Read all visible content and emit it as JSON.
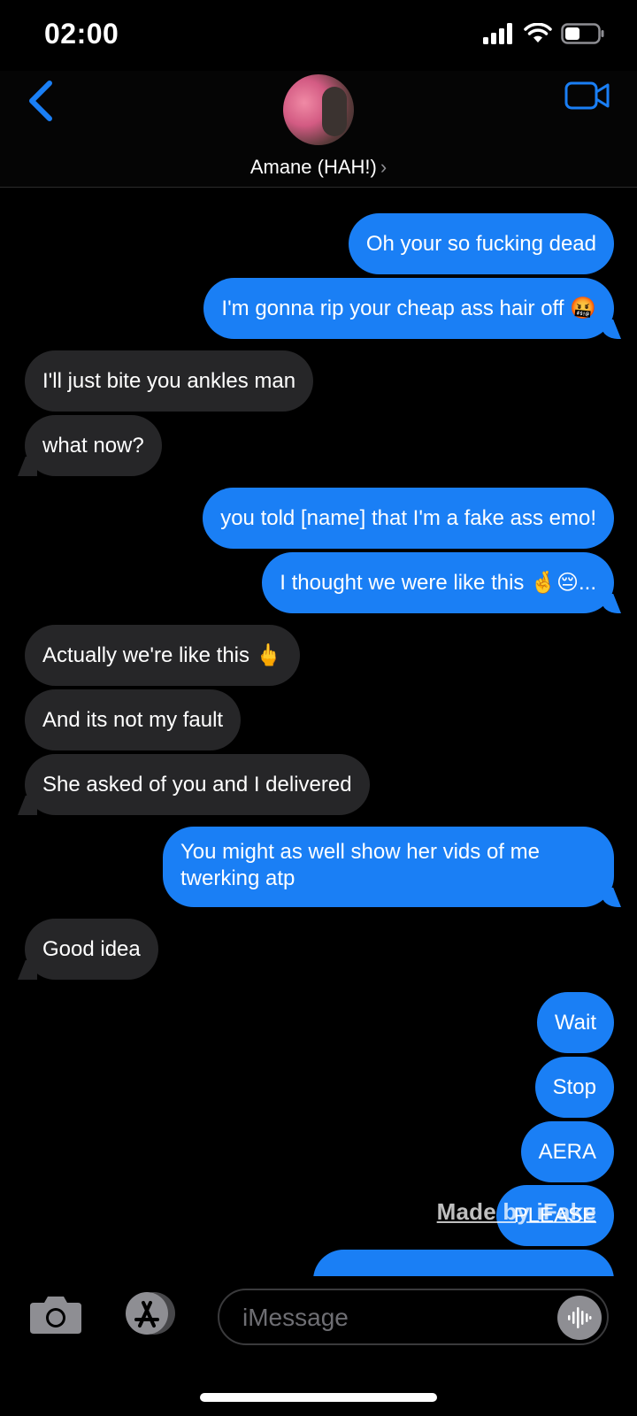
{
  "status_bar": {
    "time": "02:00"
  },
  "header": {
    "contact_name": "Amane (HAH!)",
    "chevron": "›"
  },
  "messages": [
    {
      "side": "sent",
      "text": "Oh your so fucking dead"
    },
    {
      "side": "sent",
      "text": "I'm gonna rip your cheap ass hair off 🤬"
    },
    {
      "side": "received",
      "text": "I'll just bite you ankles man"
    },
    {
      "side": "received",
      "text": "what now?"
    },
    {
      "side": "sent",
      "text": "you told [name] that I'm a fake ass emo!"
    },
    {
      "side": "sent",
      "text": "I thought we were like this 🤞😔..."
    },
    {
      "side": "received",
      "text": "Actually we're like this 🖕"
    },
    {
      "side": "received",
      "text": "And its not my fault"
    },
    {
      "side": "received",
      "text": "She asked of you and I delivered"
    },
    {
      "side": "sent",
      "text": "You might as well show her vids of me twerking atp"
    },
    {
      "side": "received",
      "text": "Good idea"
    },
    {
      "side": "sent",
      "text": "Wait"
    },
    {
      "side": "sent",
      "text": "Stop"
    },
    {
      "side": "sent",
      "text": "AERA"
    },
    {
      "side": "sent",
      "text": "PLEASE"
    }
  ],
  "watermark": "Made by iFake",
  "input": {
    "placeholder": "iMessage"
  },
  "icons": {
    "back": "chevron-left-icon",
    "video": "video-camera-icon",
    "camera": "camera-icon",
    "apps": "app-store-icon",
    "audio": "audio-waveform-icon",
    "signal": "cellular-signal-icon",
    "wifi": "wifi-icon",
    "battery": "battery-icon"
  },
  "colors": {
    "sent_bubble": "#1a7ff5",
    "received_bubble": "#262628",
    "accent": "#1a7ff5"
  }
}
